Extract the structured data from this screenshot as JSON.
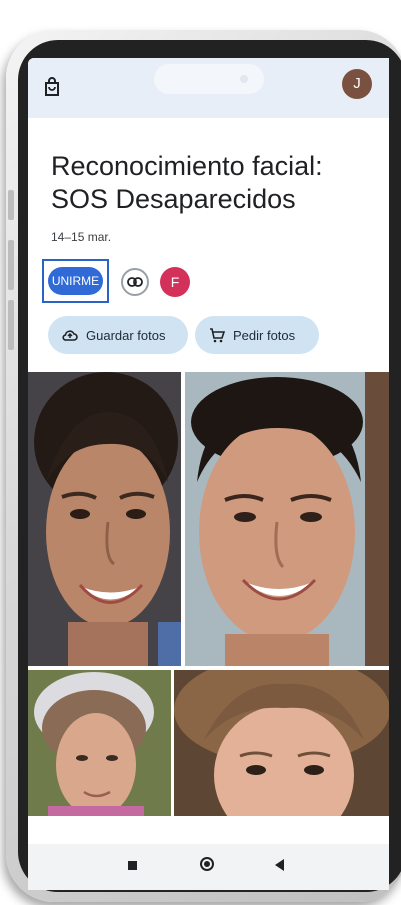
{
  "header": {
    "bag_icon": "shopping-bag-icon",
    "user_avatar_initial": "J",
    "user_avatar_color": "#7a5140"
  },
  "album": {
    "title": "Reconocimiento facial: SOS Desaparecidos",
    "date_range": "14–15 mar."
  },
  "actions": {
    "join_label": "UNIRME",
    "link_icon": "link-icon",
    "member_avatar_initial": "F",
    "member_avatar_color": "#d3305a",
    "save_photos_label": "Guardar fotos",
    "order_photos_label": "Pedir fotos"
  },
  "photos": [
    {
      "name": "face-woman-dark-hair"
    },
    {
      "name": "face-young-man"
    },
    {
      "name": "face-older-woman"
    },
    {
      "name": "face-child"
    }
  ],
  "colors": {
    "accent": "#2f6ad7",
    "chip_background": "#cfe3f3",
    "appbar_background": "#e8eef8"
  }
}
